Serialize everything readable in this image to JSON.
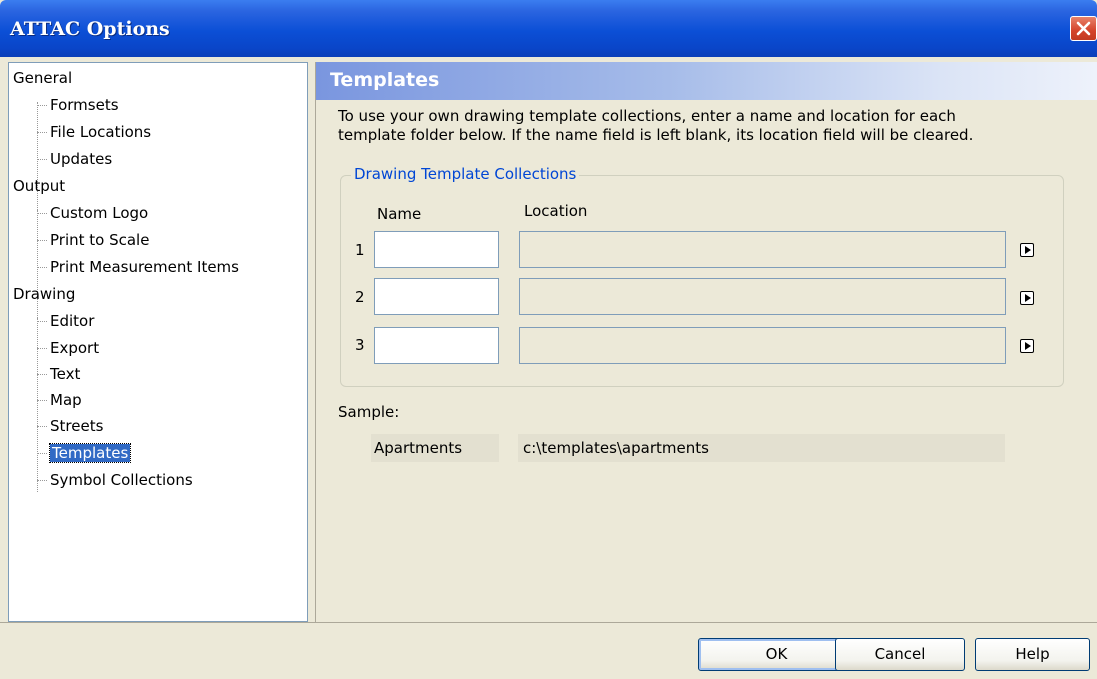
{
  "window": {
    "title": "ATTAC Options"
  },
  "tree": {
    "items": [
      {
        "label": "General",
        "level": 0
      },
      {
        "label": "Formsets",
        "level": 1
      },
      {
        "label": "File Locations",
        "level": 1
      },
      {
        "label": "Updates",
        "level": 1
      },
      {
        "label": "Output",
        "level": 0
      },
      {
        "label": "Custom Logo",
        "level": 1
      },
      {
        "label": "Print to Scale",
        "level": 1
      },
      {
        "label": "Print Measurement Items",
        "level": 1
      },
      {
        "label": "Drawing",
        "level": 0
      },
      {
        "label": "Editor",
        "level": 1
      },
      {
        "label": "Export",
        "level": 1
      },
      {
        "label": "Text",
        "level": 1
      },
      {
        "label": "Map",
        "level": 1
      },
      {
        "label": "Streets",
        "level": 1
      },
      {
        "label": "Templates",
        "level": 1,
        "selected": true
      },
      {
        "label": "Symbol Collections",
        "level": 1
      }
    ]
  },
  "panel": {
    "title": "Templates",
    "description_line1": "To use your own drawing template collections, enter a name and location for each",
    "description_line2": "template folder below.  If the name field is left blank, its location field will be cleared.",
    "group_title": "Drawing Template Collections",
    "col_name": "Name",
    "col_location": "Location",
    "rows": [
      {
        "num": "1",
        "name": "",
        "location": ""
      },
      {
        "num": "2",
        "name": "",
        "location": ""
      },
      {
        "num": "3",
        "name": "",
        "location": ""
      }
    ],
    "sample_label": "Sample:",
    "sample_name": "Apartments",
    "sample_location": "c:\\templates\\apartments"
  },
  "buttons": {
    "ok": "OK",
    "cancel": "Cancel",
    "help": "Help"
  },
  "icons": {
    "close": "close-icon",
    "browse": "arrow-right-icon"
  },
  "colors": {
    "title_bar": "#0a45c8",
    "selection": "#316ac5",
    "group_title": "#0046d5",
    "close_button": "#d4432b"
  }
}
